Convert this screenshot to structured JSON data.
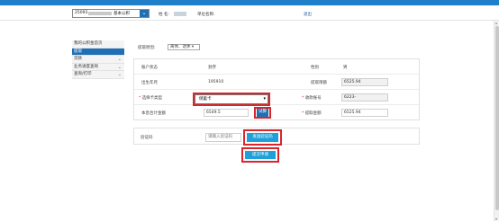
{
  "header": {
    "account_prefix": "25093",
    "account_suffix": "基本公积",
    "name_label": "姓  名:",
    "unit_label": "单位名称:",
    "logout_label": "退出"
  },
  "sidebar": {
    "items": [
      {
        "label": "我的公积金首页"
      },
      {
        "label": "提取"
      },
      {
        "label": "贷款"
      },
      {
        "label": "业务进度查询"
      },
      {
        "label": "查询/打印"
      }
    ]
  },
  "reason": {
    "label": "提取原因:",
    "value": "离休、退休"
  },
  "form": {
    "account_status_label": "账户状态",
    "account_status_value": "封存",
    "gender_label": "性别",
    "gender_value": "男",
    "birth_label": "出生年月",
    "birth_value": "195910",
    "limit_label": "提取限额",
    "limit_value": "6525.94",
    "card_type_label": "选择卡类型",
    "card_type_value": "储蓄卡",
    "bank_account_label": "收款账号",
    "bank_account_value": "6223-",
    "interest_label": "本息合计金额",
    "interest_value": "6549.5",
    "trial_label": "试算",
    "withdraw_label": "提取金额",
    "withdraw_value": "6525.94",
    "required_mark": "*"
  },
  "verify": {
    "label": "验证码",
    "placeholder": "请输入验证码",
    "send_label": "发送验证码"
  },
  "submit": {
    "label": "提交申请"
  },
  "colors": {
    "brand_blue": "#1f6fb5",
    "topbar_blue": "#1f7fc8",
    "button_cyan": "#1ea0d8",
    "highlight_red": "#d9252c"
  }
}
